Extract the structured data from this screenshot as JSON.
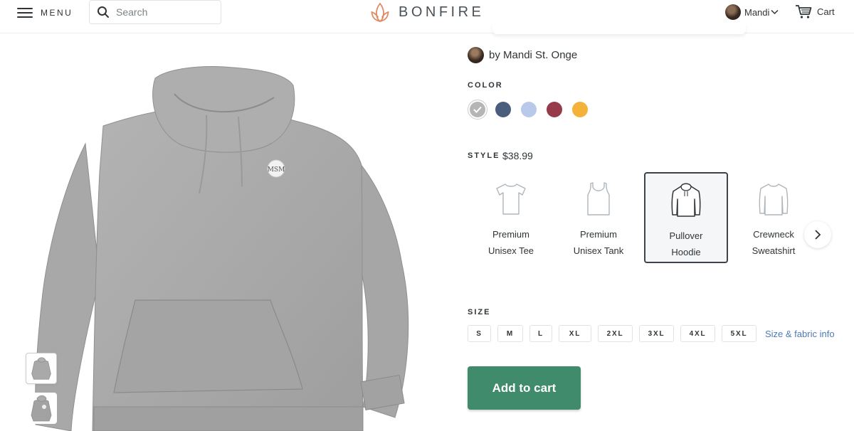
{
  "header": {
    "menu_label": "MENU",
    "search_placeholder": "Search",
    "brand": "BONFIRE",
    "account_name": "Mandi",
    "cart_label": "Cart"
  },
  "product": {
    "creator": "by Mandi St. Onge",
    "color_label": "COLOR",
    "colors": [
      {
        "name": "heather-grey",
        "hex": "#b5b5b5",
        "selected": true
      },
      {
        "name": "navy-heather",
        "hex": "#4b5d7d",
        "selected": false
      },
      {
        "name": "light-blue",
        "hex": "#b9c9ea",
        "selected": false
      },
      {
        "name": "maroon",
        "hex": "#973b4b",
        "selected": false
      },
      {
        "name": "gold",
        "hex": "#f4b23b",
        "selected": false
      }
    ],
    "style_label": "STYLE",
    "style_price": "$38.99",
    "styles": [
      {
        "line1": "Premium",
        "line2": "Unisex Tee",
        "icon": "tshirt-icon"
      },
      {
        "line1": "Premium",
        "line2": "Unisex Tank",
        "icon": "tank-top-icon"
      },
      {
        "line1": "Pullover",
        "line2": "Hoodie",
        "icon": "hoodie-icon",
        "selected": true
      },
      {
        "line1": "Crewneck",
        "line2": "Sweatshirt",
        "icon": "sweatshirt-icon"
      }
    ],
    "size_label": "SIZE",
    "sizes": [
      "S",
      "M",
      "L",
      "XL",
      "2XL",
      "3XL",
      "4XL",
      "5XL"
    ],
    "size_link": "Size & fabric info",
    "add_to_cart": "Add to cart",
    "logo_monogram": "MSM"
  }
}
